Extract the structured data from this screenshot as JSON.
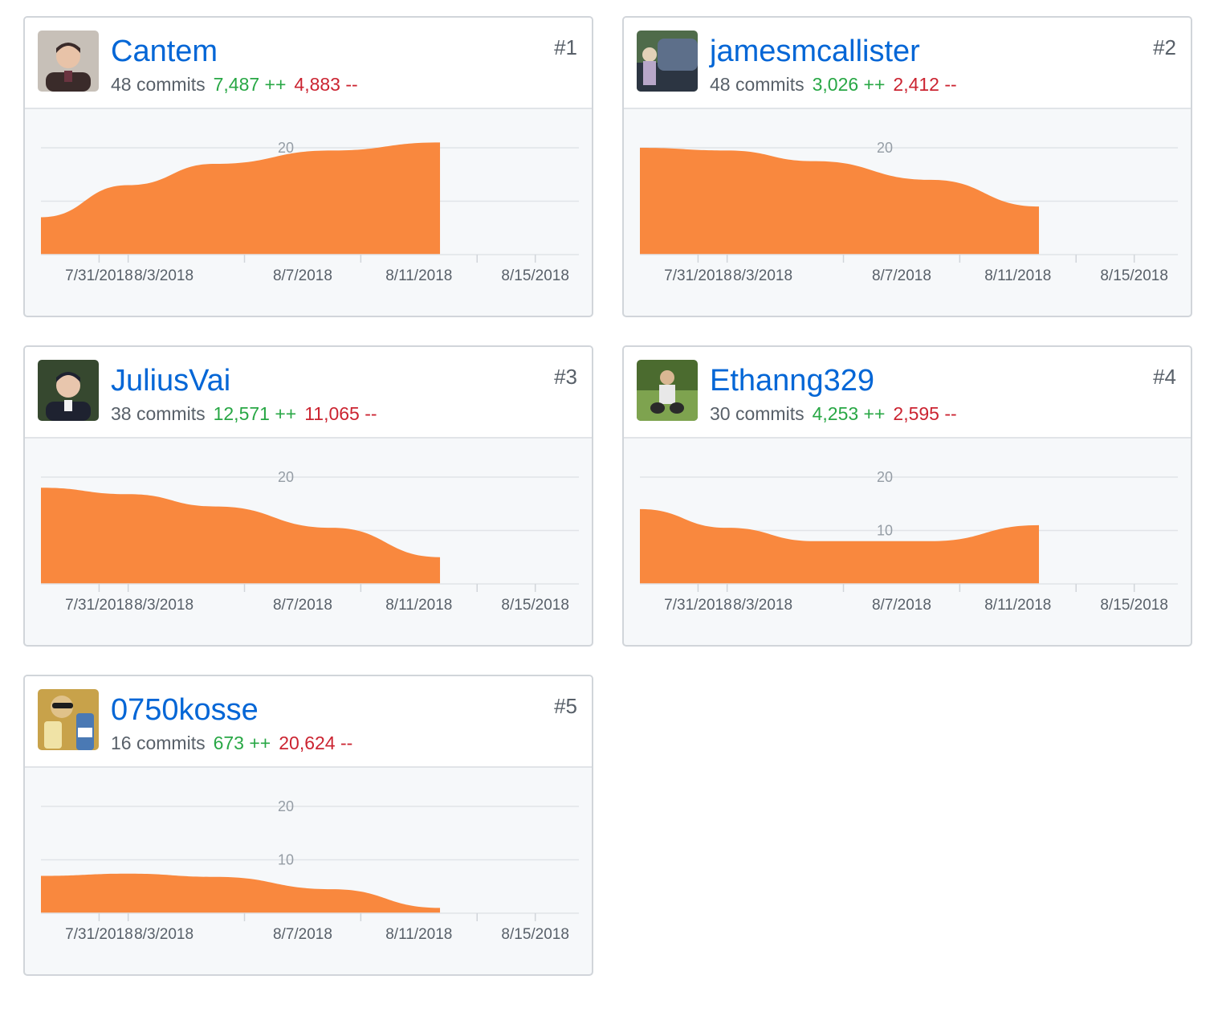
{
  "colors": {
    "area": "#f9883e",
    "link": "#0366d6",
    "additions": "#28a745",
    "deletions": "#cb2431",
    "muted": "#586069",
    "grid": "#e1e4e8",
    "tick_text": "#959da5",
    "date_text": "#586069"
  },
  "contributors": [
    {
      "rank": "#1",
      "login": "Cantem",
      "commits": "48 commits",
      "additions": "7,487 ++",
      "deletions": "4,883 --",
      "avatar_palette": [
        "#c7c0b8",
        "#3a2b2a",
        "#e8c3a8",
        "#6b3440"
      ],
      "avatar": "person-photo"
    },
    {
      "rank": "#2",
      "login": "jamesmcallister",
      "commits": "48 commits",
      "additions": "3,026 ++",
      "deletions": "2,412 --",
      "avatar_palette": [
        "#4f6b4a",
        "#5d6f8a",
        "#e3d2b8",
        "#2c3542"
      ],
      "avatar": "car-photo"
    },
    {
      "rank": "#3",
      "login": "JuliusVai",
      "commits": "38 commits",
      "additions": "12,571 ++",
      "deletions": "11,065 --",
      "avatar_palette": [
        "#36482f",
        "#1e2230",
        "#e8c6ad",
        "#f2f2f2"
      ],
      "avatar": "person-photo"
    },
    {
      "rank": "#4",
      "login": "Ethanng329",
      "commits": "30 commits",
      "additions": "4,253 ++",
      "deletions": "2,595 --",
      "avatar_palette": [
        "#4b6b2f",
        "#7ea34f",
        "#2a2a2a",
        "#d9b793"
      ],
      "avatar": "outdoor-photo"
    },
    {
      "rank": "#5",
      "login": "0750kosse",
      "commits": "16 commits",
      "additions": "673 ++",
      "deletions": "20,624 --",
      "avatar_palette": [
        "#c8a24a",
        "#1d1d1d",
        "#e0c28a",
        "#4a79b4"
      ],
      "avatar": "drink-photo"
    }
  ],
  "chart_data": [
    {
      "type": "area",
      "series_owner": "Cantem",
      "x": [
        "7/29/2018",
        "8/1/2018",
        "8/4/2018",
        "8/8/2018",
        "8/12/2018"
      ],
      "y": [
        7,
        13,
        17,
        19.5,
        21
      ],
      "x_ticks": [
        "7/31/2018",
        "8/3/2018",
        "8/7/2018",
        "8/11/2018",
        "8/15/2018"
      ],
      "y_ticks": [
        "20"
      ],
      "ylim": [
        0,
        20
      ],
      "grid": true
    },
    {
      "type": "area",
      "series_owner": "jamesmcallister",
      "x": [
        "7/29/2018",
        "8/1/2018",
        "8/4/2018",
        "8/8/2018",
        "8/12/2018"
      ],
      "y": [
        20,
        19.5,
        17.5,
        14,
        9
      ],
      "x_ticks": [
        "7/31/2018",
        "8/3/2018",
        "8/7/2018",
        "8/11/2018",
        "8/15/2018"
      ],
      "y_ticks": [
        "20"
      ],
      "ylim": [
        0,
        20
      ],
      "grid": true
    },
    {
      "type": "area",
      "series_owner": "JuliusVai",
      "x": [
        "7/29/2018",
        "8/1/2018",
        "8/4/2018",
        "8/8/2018",
        "8/12/2018"
      ],
      "y": [
        18,
        16.8,
        14.5,
        10.5,
        5
      ],
      "x_ticks": [
        "7/31/2018",
        "8/3/2018",
        "8/7/2018",
        "8/11/2018",
        "8/15/2018"
      ],
      "y_ticks": [
        "20"
      ],
      "ylim": [
        0,
        20
      ],
      "grid": true
    },
    {
      "type": "area",
      "series_owner": "Ethanng329",
      "x": [
        "7/29/2018",
        "8/1/2018",
        "8/4/2018",
        "8/8/2018",
        "8/12/2018"
      ],
      "y": [
        14,
        10.5,
        8,
        8,
        11
      ],
      "x_ticks": [
        "7/31/2018",
        "8/3/2018",
        "8/7/2018",
        "8/11/2018",
        "8/15/2018"
      ],
      "y_ticks": [
        "20",
        "10"
      ],
      "ylim": [
        0,
        20
      ],
      "grid": true
    },
    {
      "type": "area",
      "series_owner": "0750kosse",
      "x": [
        "7/29/2018",
        "8/1/2018",
        "8/4/2018",
        "8/8/2018",
        "8/12/2018"
      ],
      "y": [
        7,
        7.4,
        6.8,
        4.5,
        1
      ],
      "x_ticks": [
        "7/31/2018",
        "8/3/2018",
        "8/7/2018",
        "8/11/2018",
        "8/15/2018"
      ],
      "y_ticks": [
        "20",
        "10"
      ],
      "ylim": [
        0,
        20
      ],
      "grid": true
    }
  ]
}
